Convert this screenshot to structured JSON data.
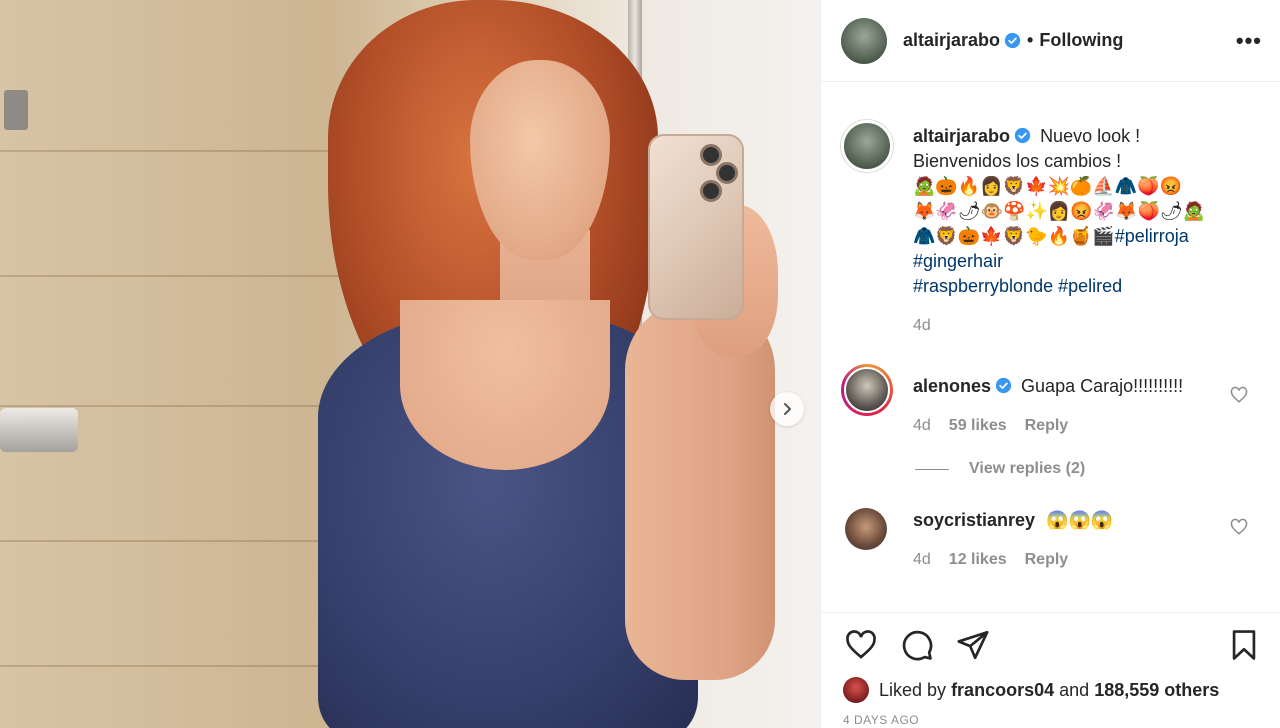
{
  "post": {
    "author": "altairjarabo",
    "follow_status": "Following",
    "separator": "•",
    "more_label": "•••",
    "image_alt": "Mirror selfie"
  },
  "caption": {
    "username": "altairjarabo",
    "line1": "Nuevo look !",
    "line2": "Bienvenidos los cambios !",
    "emoji_line1": "🧟🎃🔥👩🦁🍁💥🍊⛵🧥🍑😡",
    "emoji_line2": "🦊🦑🌶🐵🍄✨👩😡🦑🦊🍑🌶🧟",
    "emoji_line3": "🧥🦁🎃🍁🦁🐤🔥🍯🎬",
    "hashtags": [
      "#pelirroja",
      "#gingerhair",
      "#raspberryblonde",
      "#pelired"
    ],
    "time": "4d"
  },
  "comments": [
    {
      "username": "alenones",
      "text": "Guapa Carajo!!!!!!!!!!",
      "time": "4d",
      "likes": "59 likes",
      "reply_label": "Reply",
      "view_replies": "View replies (2)"
    },
    {
      "username": "soycristianrey",
      "text": "😱😱😱",
      "time": "4d",
      "likes": "12 likes",
      "reply_label": "Reply"
    }
  ],
  "actions": {
    "liked_prefix": "Liked by",
    "liked_user": "francoors04",
    "liked_and": "and",
    "liked_count": "188,559 others",
    "time_ago": "4 DAYS AGO"
  },
  "colors": {
    "verified": "#3897f0",
    "text": "#262626",
    "muted": "#8e8e8e",
    "link": "#00376b"
  },
  "icons": [
    "verified-icon",
    "heart-icon",
    "comment-icon",
    "share-icon",
    "bookmark-icon",
    "chevron-right-icon",
    "more-icon"
  ]
}
